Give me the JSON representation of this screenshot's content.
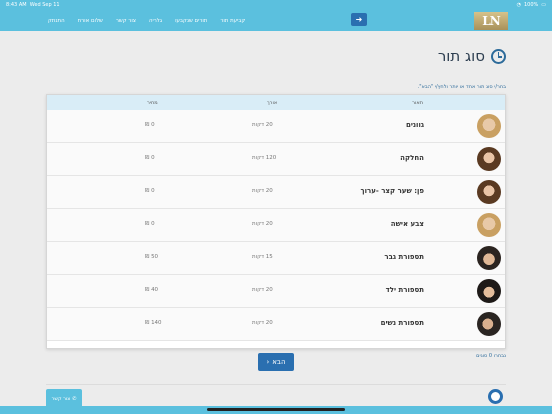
{
  "status_bar": {
    "time": "8:43 AM",
    "date": "Wed Sep 11",
    "battery": "100%"
  },
  "navbar": {
    "logo": "LN",
    "login_icon": "arrow-right-icon",
    "menu": [
      "קביעת תור",
      "תורים שנקבעו",
      "גלריה",
      "צור קשר",
      "שלום אורח",
      "התנתק"
    ]
  },
  "page": {
    "title": "סוג תור",
    "instruction": "בחר/י סוג תור אחד או יותר ולחץ/י \"הבא\".",
    "table": {
      "headers": {
        "service": "תאור",
        "duration": "אורך",
        "price": "מחיר"
      },
      "rows": [
        {
          "service": "גוונים",
          "duration": "20 דקות",
          "price": "0 ₪",
          "avatar": "woman-blonde"
        },
        {
          "service": "החלקה",
          "duration": "120 דקות",
          "price": "0 ₪",
          "avatar": "woman-brunette"
        },
        {
          "service": "פן: שער קצר -ערוך",
          "duration": "20 דקות",
          "price": "0 ₪",
          "avatar": "woman-brunette"
        },
        {
          "service": "צבע אישה",
          "duration": "20 דקות",
          "price": "0 ₪",
          "avatar": "woman-blonde"
        },
        {
          "service": "תספורת גבר",
          "duration": "15 דקות",
          "price": "50 ₪",
          "avatar": "man"
        },
        {
          "service": "תספורת ילד",
          "duration": "20 דקות",
          "price": "40 ₪",
          "avatar": "man-curly"
        },
        {
          "service": "תספורת נשים",
          "duration": "20 דקות",
          "price": "140 ₪",
          "avatar": "woman-dark"
        }
      ]
    },
    "next_button": "הבא",
    "selected_count": "נבחרו 0 סוגים"
  },
  "footer": {
    "contact_button": "צור קשר"
  },
  "colors": {
    "navbar": "#5bc0de",
    "primary": "#2a6fb0",
    "table_header": "#d9edf7"
  }
}
